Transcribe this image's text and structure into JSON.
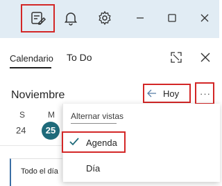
{
  "titlebar": {
    "icons": [
      "edit-note-icon",
      "bell-icon",
      "gear-icon",
      "minimize-icon",
      "maximize-icon",
      "close-icon"
    ]
  },
  "tabs": [
    {
      "label": "Calendario",
      "active": true
    },
    {
      "label": "To Do",
      "active": false
    }
  ],
  "calendar": {
    "month": "Noviembre",
    "today_button": "Hoy",
    "more_button": "···",
    "weekdays": [
      "S",
      "M"
    ],
    "days": [
      "24",
      "25"
    ],
    "today_day": "25",
    "all_day_label": "Todo el día"
  },
  "menu": {
    "header": "Alternar vistas",
    "items": [
      {
        "label": "Agenda",
        "checked": true
      },
      {
        "label": "Día",
        "checked": false
      }
    ]
  },
  "colors": {
    "titlebar_bg": "#e1ecf4",
    "highlight_box": "#d32626",
    "today_circle": "#1e6a7a",
    "check_accent": "#1e6a7a"
  }
}
